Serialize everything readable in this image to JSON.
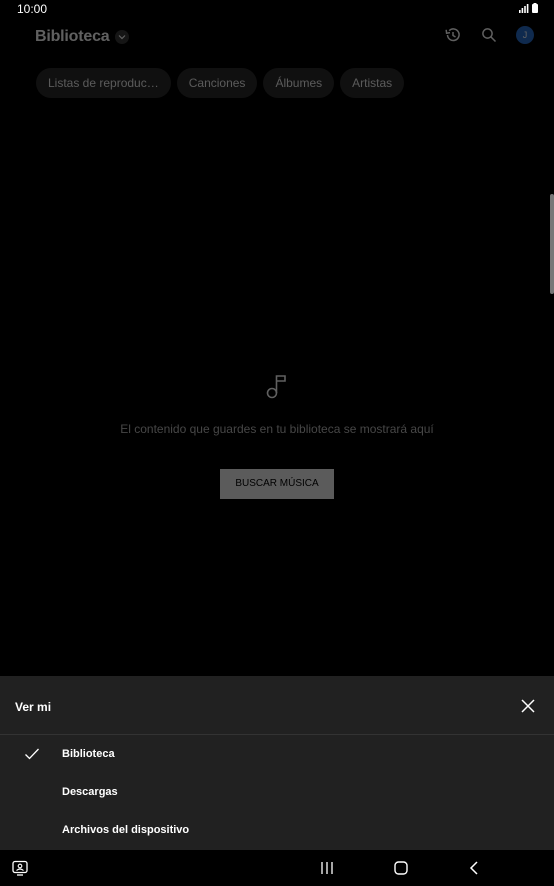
{
  "status": {
    "time": "10:00"
  },
  "header": {
    "title": "Biblioteca",
    "avatar_letter": "J"
  },
  "chips": [
    {
      "label": "Listas de reproduc…"
    },
    {
      "label": "Canciones"
    },
    {
      "label": "Álbumes"
    },
    {
      "label": "Artistas"
    }
  ],
  "empty_state": {
    "message": "El contenido que guardes en tu biblioteca se mostrará aquí",
    "button_label": "BUSCAR MÚSICA"
  },
  "sheet": {
    "title": "Ver mi",
    "items": [
      {
        "label": "Biblioteca",
        "selected": true
      },
      {
        "label": "Descargas",
        "selected": false
      },
      {
        "label": "Archivos del dispositivo",
        "selected": false
      }
    ]
  },
  "colors": {
    "avatar": "#2a6fcf",
    "sheet_bg": "#212121",
    "chip_bg": "#2b2b2b"
  },
  "icons": [
    "history-icon",
    "search-icon",
    "music-note-icon",
    "close-icon",
    "checkmark-icon",
    "recent-apps-icon",
    "home-icon",
    "back-icon",
    "keyboard-icon"
  ]
}
